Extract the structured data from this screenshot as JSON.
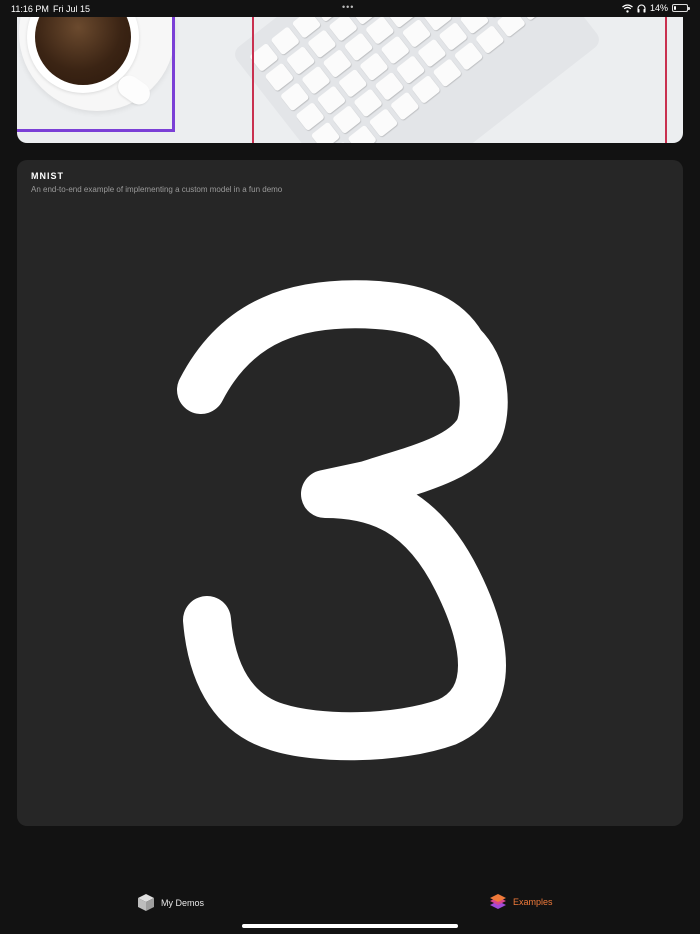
{
  "status": {
    "time": "11:16 PM",
    "date": "Fri Jul 15",
    "battery": "14%",
    "battery_level": 0.14,
    "dots": "•••"
  },
  "card": {
    "title": "MNIST",
    "subtitle": "An end-to-end example of implementing a custom model in a fun demo"
  },
  "tabs": {
    "my_demos": "My Demos",
    "examples": "Examples"
  },
  "colors": {
    "accent": "#f07a3a",
    "card_bg": "#262626",
    "app_bg": "#121212",
    "stroke": "#ffffff"
  }
}
